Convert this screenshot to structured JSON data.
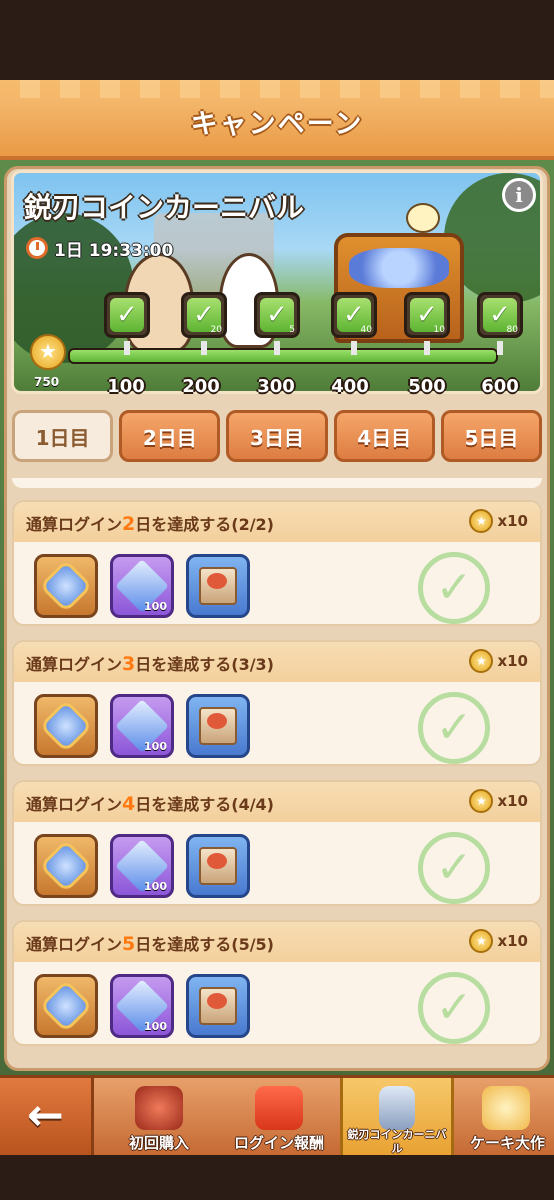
{
  "header": {
    "title": "キャンペーン"
  },
  "banner": {
    "title": "鋭刃コインカーニバル",
    "timer": "1日 19:33:00",
    "score": "750",
    "progress_fraction": 1.0,
    "milestones": [
      {
        "label": "100",
        "qty": ""
      },
      {
        "label": "200",
        "qty": "20"
      },
      {
        "label": "300",
        "qty": "5"
      },
      {
        "label": "400",
        "qty": "40"
      },
      {
        "label": "500",
        "qty": "10"
      },
      {
        "label": "600",
        "qty": "80"
      }
    ]
  },
  "tabs": [
    "1日目",
    "2日目",
    "3日目",
    "4日目",
    "5日目"
  ],
  "missions": [
    {
      "prefix": "通算ログイン",
      "num": "2",
      "suffix": "日を達成する(2/2)",
      "reward": "x10",
      "gem_qty": "100"
    },
    {
      "prefix": "通算ログイン",
      "num": "3",
      "suffix": "日を達成する(3/3)",
      "reward": "x10",
      "gem_qty": "100"
    },
    {
      "prefix": "通算ログイン",
      "num": "4",
      "suffix": "日を達成する(4/4)",
      "reward": "x10",
      "gem_qty": "100"
    },
    {
      "prefix": "通算ログイン",
      "num": "5",
      "suffix": "日を達成する(5/5)",
      "reward": "x10",
      "gem_qty": "100"
    }
  ],
  "bottom_nav": {
    "back": "←",
    "items": [
      "初回購入",
      "ログイン報酬",
      "鋭刃コインカーニバル",
      "ケーキ大作"
    ]
  },
  "icons": {
    "check": "✓",
    "info": "i",
    "star": "★"
  },
  "colors": {
    "accent_orange": "#ff7a12",
    "check_green": "#5eb432"
  }
}
